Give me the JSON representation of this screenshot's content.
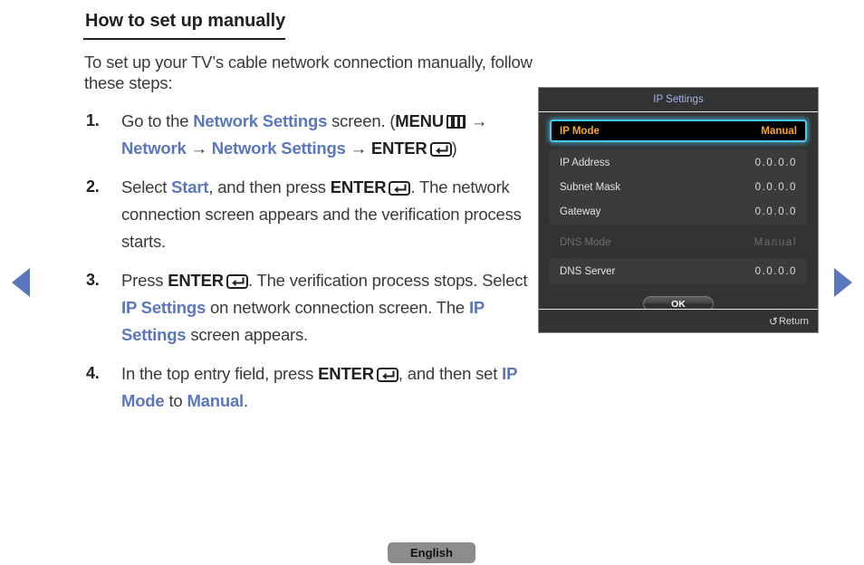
{
  "page": {
    "title": "How to set up manually",
    "intro": "To set up your TV’s cable network connection manually, follow these steps:",
    "language_badge": "English"
  },
  "nav": {
    "prev_icon": "triangle-left-icon",
    "next_icon": "triangle-right-icon",
    "arrow_color": "#5a77bd"
  },
  "steps": [
    {
      "number": "1.",
      "segments": [
        {
          "text": "Go to the ",
          "style": "plain"
        },
        {
          "text": "Network Settings",
          "style": "blue"
        },
        {
          "text": " screen. (",
          "style": "plain"
        },
        {
          "text": "MENU",
          "style": "bold"
        },
        {
          "text": "menu-icon",
          "style": "icon-menu"
        },
        {
          "text": " → ",
          "style": "plain"
        },
        {
          "text": "Network",
          "style": "blue"
        },
        {
          "text": " → ",
          "style": "plain"
        },
        {
          "text": "Network Settings",
          "style": "blue"
        },
        {
          "text": " → ",
          "style": "plain"
        },
        {
          "text": "ENTER",
          "style": "bold"
        },
        {
          "text": "enter-icon",
          "style": "icon-enter"
        },
        {
          "text": ")",
          "style": "plain"
        }
      ]
    },
    {
      "number": "2.",
      "segments": [
        {
          "text": "Select ",
          "style": "plain"
        },
        {
          "text": "Start",
          "style": "blue"
        },
        {
          "text": ", and then press ",
          "style": "plain"
        },
        {
          "text": "ENTER",
          "style": "bold"
        },
        {
          "text": "enter-icon",
          "style": "icon-enter"
        },
        {
          "text": ". The network connection screen appears and the verification process starts.",
          "style": "plain"
        }
      ]
    },
    {
      "number": "3.",
      "segments": [
        {
          "text": "Press ",
          "style": "plain"
        },
        {
          "text": "ENTER",
          "style": "bold"
        },
        {
          "text": "enter-icon",
          "style": "icon-enter"
        },
        {
          "text": ". The verification process stops. Select ",
          "style": "plain"
        },
        {
          "text": "IP Settings",
          "style": "blue"
        },
        {
          "text": " on network connection screen. The ",
          "style": "plain"
        },
        {
          "text": "IP Settings",
          "style": "blue"
        },
        {
          "text": " screen appears.",
          "style": "plain"
        }
      ]
    },
    {
      "number": "4.",
      "segments": [
        {
          "text": "In the top entry field, press ",
          "style": "plain"
        },
        {
          "text": "ENTER",
          "style": "bold"
        },
        {
          "text": "enter-icon",
          "style": "icon-enter"
        },
        {
          "text": ", and then set ",
          "style": "plain"
        },
        {
          "text": "IP Mode",
          "style": "blue"
        },
        {
          "text": " to ",
          "style": "plain"
        },
        {
          "text": "Manual",
          "style": "blue"
        },
        {
          "text": ".",
          "style": "plain"
        }
      ]
    }
  ],
  "tv_panel": {
    "title": "IP Settings",
    "title_color": "#9fb4e8",
    "selected_row": {
      "label": "IP Mode",
      "value": "Manual",
      "highlight_color": "#45c8f0",
      "text_color": "#f5a623"
    },
    "fields": [
      {
        "label": "IP Address",
        "value": "0.0.0.0"
      },
      {
        "label": "Subnet Mask",
        "value": "0.0.0.0"
      },
      {
        "label": "Gateway",
        "value": "0.0.0.0"
      }
    ],
    "dns_mode": {
      "label": "DNS Mode",
      "value": "Manual",
      "disabled": true
    },
    "dns_server": {
      "label": "DNS Server",
      "value": "0.0.0.0"
    },
    "ok_button": "OK",
    "return_label": "Return",
    "return_icon": "↺"
  }
}
